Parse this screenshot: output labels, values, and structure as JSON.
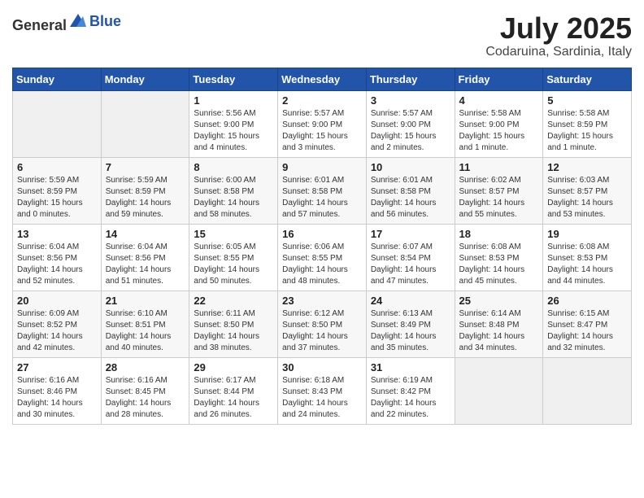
{
  "header": {
    "logo_general": "General",
    "logo_blue": "Blue",
    "month": "July 2025",
    "location": "Codaruina, Sardinia, Italy"
  },
  "weekdays": [
    "Sunday",
    "Monday",
    "Tuesday",
    "Wednesday",
    "Thursday",
    "Friday",
    "Saturday"
  ],
  "rows": [
    [
      {
        "day": "",
        "info": ""
      },
      {
        "day": "",
        "info": ""
      },
      {
        "day": "1",
        "info": "Sunrise: 5:56 AM\nSunset: 9:00 PM\nDaylight: 15 hours and 4 minutes."
      },
      {
        "day": "2",
        "info": "Sunrise: 5:57 AM\nSunset: 9:00 PM\nDaylight: 15 hours and 3 minutes."
      },
      {
        "day": "3",
        "info": "Sunrise: 5:57 AM\nSunset: 9:00 PM\nDaylight: 15 hours and 2 minutes."
      },
      {
        "day": "4",
        "info": "Sunrise: 5:58 AM\nSunset: 9:00 PM\nDaylight: 15 hours and 1 minute."
      },
      {
        "day": "5",
        "info": "Sunrise: 5:58 AM\nSunset: 8:59 PM\nDaylight: 15 hours and 1 minute."
      }
    ],
    [
      {
        "day": "6",
        "info": "Sunrise: 5:59 AM\nSunset: 8:59 PM\nDaylight: 15 hours and 0 minutes."
      },
      {
        "day": "7",
        "info": "Sunrise: 5:59 AM\nSunset: 8:59 PM\nDaylight: 14 hours and 59 minutes."
      },
      {
        "day": "8",
        "info": "Sunrise: 6:00 AM\nSunset: 8:58 PM\nDaylight: 14 hours and 58 minutes."
      },
      {
        "day": "9",
        "info": "Sunrise: 6:01 AM\nSunset: 8:58 PM\nDaylight: 14 hours and 57 minutes."
      },
      {
        "day": "10",
        "info": "Sunrise: 6:01 AM\nSunset: 8:58 PM\nDaylight: 14 hours and 56 minutes."
      },
      {
        "day": "11",
        "info": "Sunrise: 6:02 AM\nSunset: 8:57 PM\nDaylight: 14 hours and 55 minutes."
      },
      {
        "day": "12",
        "info": "Sunrise: 6:03 AM\nSunset: 8:57 PM\nDaylight: 14 hours and 53 minutes."
      }
    ],
    [
      {
        "day": "13",
        "info": "Sunrise: 6:04 AM\nSunset: 8:56 PM\nDaylight: 14 hours and 52 minutes."
      },
      {
        "day": "14",
        "info": "Sunrise: 6:04 AM\nSunset: 8:56 PM\nDaylight: 14 hours and 51 minutes."
      },
      {
        "day": "15",
        "info": "Sunrise: 6:05 AM\nSunset: 8:55 PM\nDaylight: 14 hours and 50 minutes."
      },
      {
        "day": "16",
        "info": "Sunrise: 6:06 AM\nSunset: 8:55 PM\nDaylight: 14 hours and 48 minutes."
      },
      {
        "day": "17",
        "info": "Sunrise: 6:07 AM\nSunset: 8:54 PM\nDaylight: 14 hours and 47 minutes."
      },
      {
        "day": "18",
        "info": "Sunrise: 6:08 AM\nSunset: 8:53 PM\nDaylight: 14 hours and 45 minutes."
      },
      {
        "day": "19",
        "info": "Sunrise: 6:08 AM\nSunset: 8:53 PM\nDaylight: 14 hours and 44 minutes."
      }
    ],
    [
      {
        "day": "20",
        "info": "Sunrise: 6:09 AM\nSunset: 8:52 PM\nDaylight: 14 hours and 42 minutes."
      },
      {
        "day": "21",
        "info": "Sunrise: 6:10 AM\nSunset: 8:51 PM\nDaylight: 14 hours and 40 minutes."
      },
      {
        "day": "22",
        "info": "Sunrise: 6:11 AM\nSunset: 8:50 PM\nDaylight: 14 hours and 38 minutes."
      },
      {
        "day": "23",
        "info": "Sunrise: 6:12 AM\nSunset: 8:50 PM\nDaylight: 14 hours and 37 minutes."
      },
      {
        "day": "24",
        "info": "Sunrise: 6:13 AM\nSunset: 8:49 PM\nDaylight: 14 hours and 35 minutes."
      },
      {
        "day": "25",
        "info": "Sunrise: 6:14 AM\nSunset: 8:48 PM\nDaylight: 14 hours and 34 minutes."
      },
      {
        "day": "26",
        "info": "Sunrise: 6:15 AM\nSunset: 8:47 PM\nDaylight: 14 hours and 32 minutes."
      }
    ],
    [
      {
        "day": "27",
        "info": "Sunrise: 6:16 AM\nSunset: 8:46 PM\nDaylight: 14 hours and 30 minutes."
      },
      {
        "day": "28",
        "info": "Sunrise: 6:16 AM\nSunset: 8:45 PM\nDaylight: 14 hours and 28 minutes."
      },
      {
        "day": "29",
        "info": "Sunrise: 6:17 AM\nSunset: 8:44 PM\nDaylight: 14 hours and 26 minutes."
      },
      {
        "day": "30",
        "info": "Sunrise: 6:18 AM\nSunset: 8:43 PM\nDaylight: 14 hours and 24 minutes."
      },
      {
        "day": "31",
        "info": "Sunrise: 6:19 AM\nSunset: 8:42 PM\nDaylight: 14 hours and 22 minutes."
      },
      {
        "day": "",
        "info": ""
      },
      {
        "day": "",
        "info": ""
      }
    ]
  ]
}
